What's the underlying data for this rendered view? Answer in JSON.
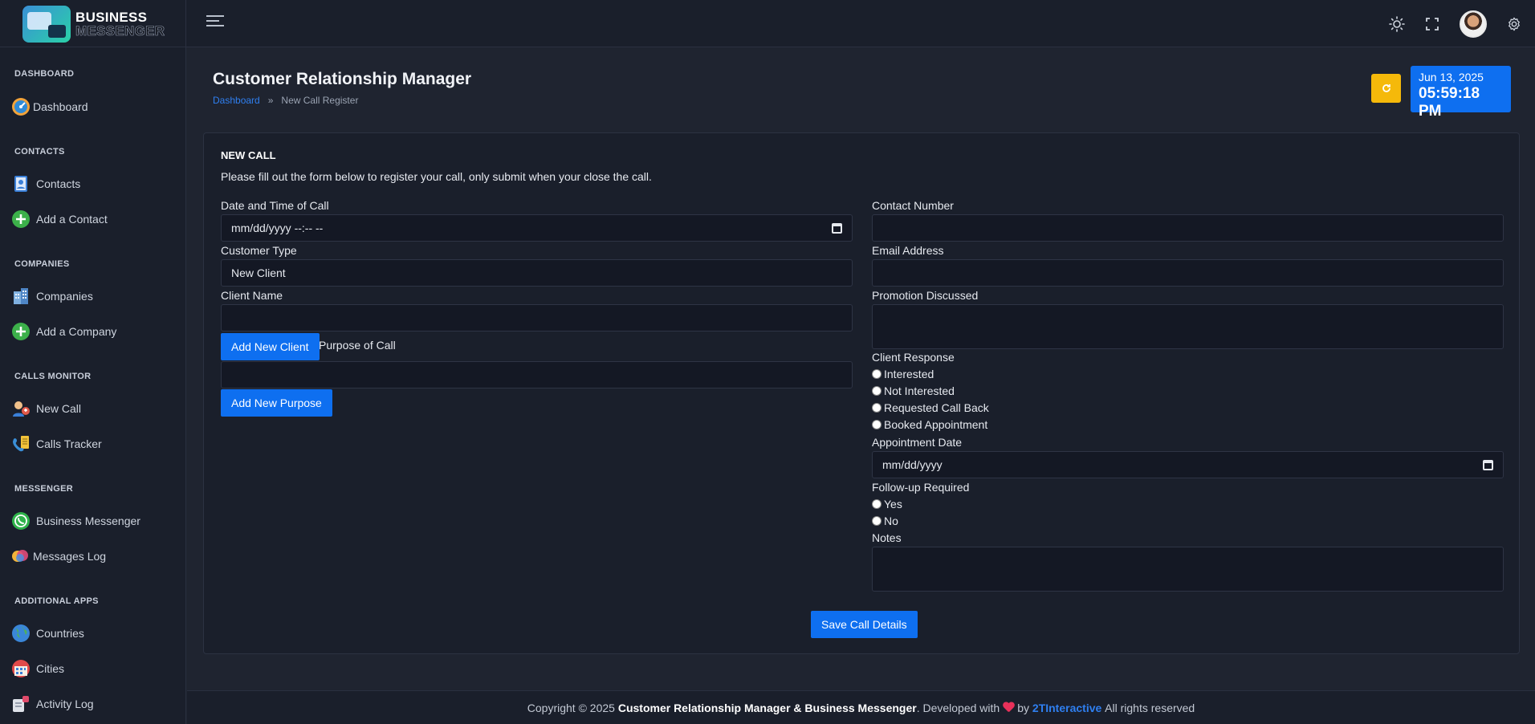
{
  "brand": {
    "line1": "BUSINESS",
    "line2": "MESSENGER"
  },
  "sidebar": {
    "sections": [
      {
        "title": "DASHBOARD",
        "items": [
          {
            "label": "Dashboard",
            "icon": "dashboard-icon"
          }
        ]
      },
      {
        "title": "CONTACTS",
        "items": [
          {
            "label": "Contacts",
            "icon": "contacts-book-icon"
          },
          {
            "label": "Add a Contact",
            "icon": "add-circle-icon"
          }
        ]
      },
      {
        "title": "COMPANIES",
        "items": [
          {
            "label": "Companies",
            "icon": "building-icon"
          },
          {
            "label": "Add a Company",
            "icon": "add-circle-icon"
          }
        ]
      },
      {
        "title": "CALLS MONITOR",
        "items": [
          {
            "label": "New Call",
            "icon": "new-call-icon"
          },
          {
            "label": "Calls Tracker",
            "icon": "phone-tracker-icon"
          }
        ]
      },
      {
        "title": "MESSENGER",
        "items": [
          {
            "label": "Business Messenger",
            "icon": "whatsapp-icon"
          },
          {
            "label": "Messages Log",
            "icon": "chat-bubbles-icon"
          }
        ]
      },
      {
        "title": "ADDITIONAL APPS",
        "items": [
          {
            "label": "Countries",
            "icon": "globe-icon"
          },
          {
            "label": "Cities",
            "icon": "city-icon"
          },
          {
            "label": "Activity Log",
            "icon": "activity-log-icon"
          }
        ]
      }
    ]
  },
  "header": {
    "title": "Customer Relationship Manager",
    "breadcrumb": {
      "home": "Dashboard",
      "separator": "»",
      "current": "New Call Register"
    },
    "date": "Jun 13, 2025",
    "time": "05:59:18 PM"
  },
  "form": {
    "title": "NEW CALL",
    "description": "Please fill out the form below to register your call, only submit when your close the call.",
    "date_time_label": "Date and Time of Call",
    "date_time_value": "mm/dd/yyyy --:-- --",
    "customer_type_label": "Customer Type",
    "customer_type_value": "New Client",
    "client_name_label": "Client Name",
    "add_client_button": "Add New Client",
    "purpose_label": "Purpose of Call",
    "add_purpose_button": "Add New Purpose",
    "contact_number_label": "Contact Number",
    "email_label": "Email Address",
    "promotion_label": "Promotion Discussed",
    "client_response_label": "Client Response",
    "client_response_options": [
      "Interested",
      "Not Interested",
      "Requested Call Back",
      "Booked Appointment"
    ],
    "appointment_date_label": "Appointment Date",
    "appointment_date_value": "mm/dd/yyyy",
    "follow_up_label": "Follow-up Required",
    "follow_up_options": [
      "Yes",
      "No"
    ],
    "notes_label": "Notes",
    "save_button": "Save Call Details"
  },
  "footer": {
    "prefix": "Copyright © 2025",
    "app_name": "Customer Relationship Manager & Business Messenger",
    "developed": ". Developed with",
    "by": "by",
    "company": "2TInteractive",
    "suffix": "All rights reserved"
  },
  "colors": {
    "accent_blue": "#0e6ff0",
    "refresh_yellow": "#f5b90a",
    "background": "#1f2430",
    "panel": "#1a1f2b"
  }
}
